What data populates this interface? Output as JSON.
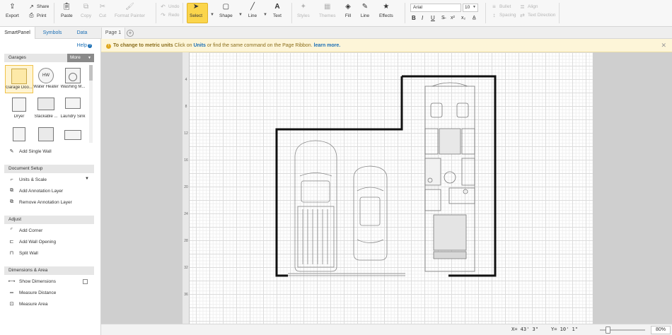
{
  "ribbon": {
    "export": "Export",
    "share": "Share",
    "print": "Print",
    "paste": "Paste",
    "copy": "Copy",
    "cut": "Cut",
    "format_painter": "Format Painter",
    "undo": "Undo",
    "redo": "Redo",
    "select": "Select",
    "shape": "Shape",
    "line": "Line",
    "text": "Text",
    "styles": "Styles",
    "themes": "Themes",
    "fill": "Fill",
    "line2": "Line",
    "effects": "Effects",
    "font": "Arial",
    "font_size": "10",
    "bold": "B",
    "italic": "I",
    "underline": "U",
    "bullet": "Bullet",
    "align": "Align",
    "spacing": "Spacing",
    "text_direction": "Text Direction"
  },
  "tabs": {
    "smartpanel": "SmartPanel",
    "symbols": "Symbols",
    "data": "Data",
    "page1": "Page 1"
  },
  "panel": {
    "help": "Help",
    "garages_header": "Garages",
    "more": "More",
    "library": [
      {
        "label": "Garage Doo..."
      },
      {
        "label": "Water Heater",
        "badge": "HW"
      },
      {
        "label": "Washing M..."
      },
      {
        "label": "Dryer"
      },
      {
        "label": "Stackable ..."
      },
      {
        "label": "Laundry Sink"
      }
    ],
    "add_single_wall": "Add Single Wall",
    "document_setup": "Document Setup",
    "units_scale": "Units & Scale",
    "add_annotation_layer": "Add Annotation Layer",
    "remove_annotation_layer": "Remove Annotation Layer",
    "adjust": "Adjust",
    "add_corner": "Add Corner",
    "add_wall_opening": "Add Wall Opening",
    "split_wall": "Split Wall",
    "dimensions_area": "Dimensions & Area",
    "show_dimensions": "Show Dimensions",
    "measure_distance": "Measure Distance",
    "measure_area": "Measure Area"
  },
  "notice": {
    "bold": "To change to metric units",
    "t1": " Click on ",
    "units": "Units",
    "t2": " or find the same command on the Page Ribbon. ",
    "learn": "learn more."
  },
  "ruler": [
    "4",
    "8",
    "12",
    "16",
    "20",
    "24",
    "28",
    "32",
    "36"
  ],
  "status": {
    "x": "X= 43' 3\"",
    "y": "Y= 10' 1\"",
    "zoom": "80%"
  }
}
